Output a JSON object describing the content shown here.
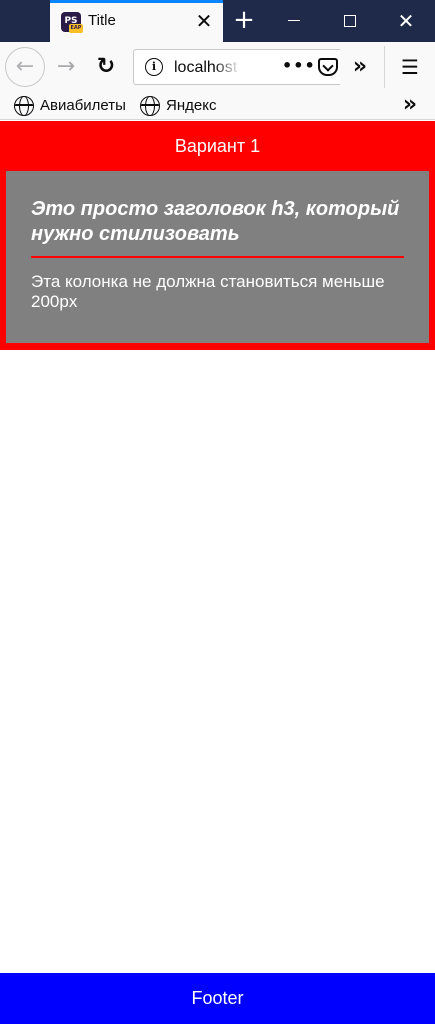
{
  "browser": {
    "tab": {
      "title": "Title",
      "favicon_icon": "phpstorm-eap-icon",
      "favicon_text": "PS",
      "favicon_badge": "EAP",
      "close_glyph": "✕"
    },
    "new_tab_glyph": "+",
    "window_controls": {
      "minimize": "minimize-icon",
      "maximize": "maximize-icon",
      "close": "✕"
    },
    "nav": {
      "back_glyph": "←",
      "forward_glyph": "→",
      "reload_glyph": "↻",
      "url": "localhost",
      "page_actions_glyph": "•••",
      "overflow_glyph": "»",
      "menu_glyph": "☰"
    },
    "bookmarks": {
      "items": [
        {
          "label": "Авиабилеты",
          "icon": "globe-icon"
        },
        {
          "label": "Яндекс",
          "icon": "globe-icon"
        }
      ],
      "overflow_glyph": "»"
    }
  },
  "page": {
    "variant": {
      "title": "Вариант 1",
      "heading": "Это просто заголовок h3, который нужно стилизовать",
      "text": "Эта колонка не должна становиться меньше 200px"
    },
    "footer": {
      "text": "Footer"
    }
  },
  "colors": {
    "variant_bg": "#ff0000",
    "card_bg": "#808080",
    "rule": "#ff0000",
    "footer_bg": "#0000ff",
    "tab_accent": "#0a84ff",
    "titlebar_bg": "#1f2a4a"
  }
}
